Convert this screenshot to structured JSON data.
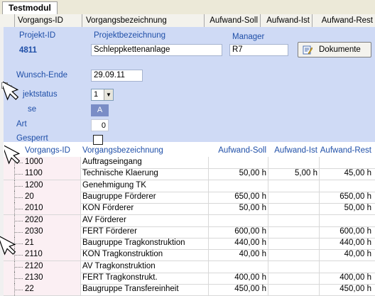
{
  "tab": {
    "label": "Testmodul"
  },
  "header": {
    "columns": [
      "Vorgangs-ID",
      "Vorgangsbezeichnung",
      "Aufwand-Soll",
      "Aufwand-Ist",
      "Aufwand-Rest"
    ]
  },
  "project": {
    "id_label": "Projekt-ID",
    "id_value": "4811",
    "name_label": "Projektbezeichnung",
    "name_value": "Schleppkettenanlage",
    "manager_label": "Manager",
    "manager_value": "R7",
    "documents_button": "Dokumente",
    "due_label": "Wunsch-Ende",
    "due_value": "29.09.11",
    "status_label": "Projektstatus",
    "status_label_visible": "jektstatus",
    "status_value": "1",
    "phase_label_visible": "se",
    "phase_value": "A",
    "type_label": "Art",
    "type_value": "0",
    "locked_label": "Gesperrt"
  },
  "subgrid": {
    "columns": [
      "Vorgangs-ID",
      "Vorgangsbezeichnung",
      "Aufwand-Soll",
      "Aufwand-Ist",
      "Aufwand-Rest"
    ],
    "rows": [
      {
        "id": "1000",
        "name": "Auftragseingang",
        "soll": "",
        "ist": "",
        "rest": ""
      },
      {
        "id": "1100",
        "name": "Technische Klaerung",
        "soll": "50,00 h",
        "ist": "5,00 h",
        "rest": "45,00 h"
      },
      {
        "id": "1200",
        "name": "Genehmigung TK",
        "soll": "",
        "ist": "",
        "rest": ""
      },
      {
        "id": "20",
        "name": "Baugruppe Förderer",
        "soll": "650,00 h",
        "ist": "",
        "rest": "650,00 h"
      },
      {
        "id": "2010",
        "name": "KON Förderer",
        "soll": "50,00 h",
        "ist": "",
        "rest": "50,00 h"
      },
      {
        "id": "2020",
        "name": "AV Förderer",
        "soll": "",
        "ist": "",
        "rest": ""
      },
      {
        "id": "2030",
        "name": "FERT Förderer",
        "soll": "600,00 h",
        "ist": "",
        "rest": "600,00 h"
      },
      {
        "id": "21",
        "name": "Baugruppe Tragkonstruktion",
        "soll": "440,00 h",
        "ist": "",
        "rest": "440,00 h"
      },
      {
        "id": "2110",
        "name": "KON Tragkonstruktion",
        "soll": "40,00 h",
        "ist": "",
        "rest": "40,00 h"
      },
      {
        "id": "2120",
        "name": "AV Tragkonstruktion",
        "soll": "",
        "ist": "",
        "rest": ""
      },
      {
        "id": "2130",
        "name": "FERT Tragkonstrukt.",
        "soll": "400,00 h",
        "ist": "",
        "rest": "400,00 h"
      },
      {
        "id": "22",
        "name": "Baugruppe Transfereinheit",
        "soll": "450,00 h",
        "ist": "",
        "rest": "450,00 h"
      }
    ]
  }
}
